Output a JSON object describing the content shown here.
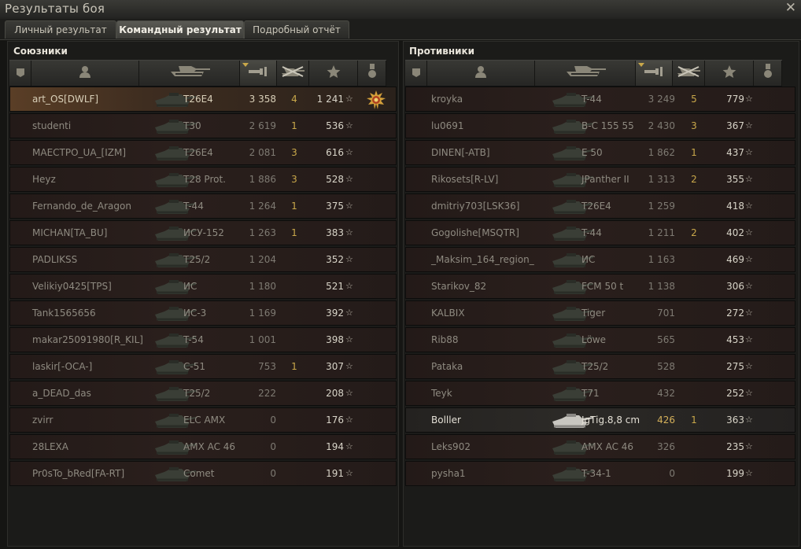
{
  "window": {
    "title": "Результаты боя"
  },
  "tabs": [
    {
      "label": "Личный результат"
    },
    {
      "label": "Командный результат"
    },
    {
      "label": "Подробный отчёт"
    }
  ],
  "allies": {
    "title": "Союзники",
    "rows": [
      {
        "player": "art_OS[DWLF]",
        "vehicle": "T26E4",
        "damage": "3 358",
        "kills": "4",
        "xp": "1 241",
        "medal": true,
        "highlight": "me"
      },
      {
        "player": "studenti",
        "vehicle": "T30",
        "damage": "2 619",
        "kills": "1",
        "xp": "536"
      },
      {
        "player": "MAECTPO_UA_[IZM]",
        "vehicle": "T26E4",
        "damage": "2 081",
        "kills": "3",
        "xp": "616"
      },
      {
        "player": "Heyz",
        "vehicle": "T28 Prot.",
        "damage": "1 886",
        "kills": "3",
        "xp": "528"
      },
      {
        "player": "Fernando_de_Aragon",
        "vehicle": "T-44",
        "damage": "1 264",
        "kills": "1",
        "xp": "375"
      },
      {
        "player": "MICHAN[TA_BU]",
        "vehicle": "ИСУ-152",
        "damage": "1 263",
        "kills": "1",
        "xp": "383"
      },
      {
        "player": "PADLIKSS",
        "vehicle": "T25/2",
        "damage": "1 204",
        "kills": "",
        "xp": "352"
      },
      {
        "player": "Velikiy0425[TPS]",
        "vehicle": "ИС",
        "damage": "1 180",
        "kills": "",
        "xp": "521"
      },
      {
        "player": "Tank1565656",
        "vehicle": "ИС-3",
        "damage": "1 169",
        "kills": "",
        "xp": "392"
      },
      {
        "player": "makar25091980[R_KIL]",
        "vehicle": "T-54",
        "damage": "1 001",
        "kills": "",
        "xp": "398"
      },
      {
        "player": "laskir[-OCA-]",
        "vehicle": "C-51",
        "damage": "753",
        "kills": "1",
        "xp": "307"
      },
      {
        "player": "a_DEAD_das",
        "vehicle": "T25/2",
        "damage": "222",
        "kills": "",
        "xp": "208"
      },
      {
        "player": "zvirr",
        "vehicle": "ELC AMX",
        "damage": "0",
        "kills": "",
        "xp": "176"
      },
      {
        "player": "28LEXA",
        "vehicle": "AMX AC 46",
        "damage": "0",
        "kills": "",
        "xp": "194"
      },
      {
        "player": "Pr0sTo_bRed[FA-RT]",
        "vehicle": "Comet",
        "damage": "0",
        "kills": "",
        "xp": "191"
      }
    ]
  },
  "enemies": {
    "title": "Противники",
    "rows": [
      {
        "player": "kroyka",
        "vehicle": "T-44",
        "damage": "3 249",
        "kills": "5",
        "xp": "779"
      },
      {
        "player": "lu0691",
        "vehicle": "B-C 155 55",
        "damage": "2 430",
        "kills": "3",
        "xp": "367"
      },
      {
        "player": "DINEN[-ATB]",
        "vehicle": "E 50",
        "damage": "1 862",
        "kills": "1",
        "xp": "437"
      },
      {
        "player": "Rikosets[R-LV]",
        "vehicle": "JPanther II",
        "damage": "1 313",
        "kills": "2",
        "xp": "355"
      },
      {
        "player": "dmitriy703[LSK36]",
        "vehicle": "T26E4",
        "damage": "1 259",
        "kills": "",
        "xp": "418"
      },
      {
        "player": "Gogolishe[MSQTR]",
        "vehicle": "T-44",
        "damage": "1 211",
        "kills": "2",
        "xp": "402"
      },
      {
        "player": "_Maksim_164_region_",
        "vehicle": "ИС",
        "damage": "1 163",
        "kills": "",
        "xp": "469"
      },
      {
        "player": "Starikov_82",
        "vehicle": "FCM 50 t",
        "damage": "1 138",
        "kills": "",
        "xp": "306"
      },
      {
        "player": "KALBIX",
        "vehicle": "Tiger",
        "damage": "701",
        "kills": "",
        "xp": "272"
      },
      {
        "player": "Rib88",
        "vehicle": "Löwe",
        "damage": "565",
        "kills": "",
        "xp": "453"
      },
      {
        "player": "Pataka",
        "vehicle": "T25/2",
        "damage": "528",
        "kills": "",
        "xp": "275"
      },
      {
        "player": "Teyk",
        "vehicle": "T71",
        "damage": "432",
        "kills": "",
        "xp": "252"
      },
      {
        "player": "Bolller",
        "vehicle": "JgTig.8,8 cm",
        "damage": "426",
        "kills": "1",
        "xp": "363",
        "highlight": "bright"
      },
      {
        "player": "Leks902",
        "vehicle": "AMX AC 46",
        "damage": "326",
        "kills": "",
        "xp": "235"
      },
      {
        "player": "pysha1",
        "vehicle": "T-34-1",
        "damage": "0",
        "kills": "",
        "xp": "199"
      }
    ]
  },
  "columns": [
    {
      "icon": "squad-icon"
    },
    {
      "icon": "player-icon"
    },
    {
      "icon": "tank-icon"
    },
    {
      "icon": "damage-icon",
      "sorted": true
    },
    {
      "icon": "kills-icon"
    },
    {
      "icon": "xp-star-icon"
    },
    {
      "icon": "medal-icon"
    }
  ],
  "colors": {
    "kills": "#c9a84a",
    "xp": "#d8d4c8",
    "row_me": "#5a3e26",
    "row_enemy": "#2a1f1c",
    "active_tab": "#4a4a44"
  }
}
